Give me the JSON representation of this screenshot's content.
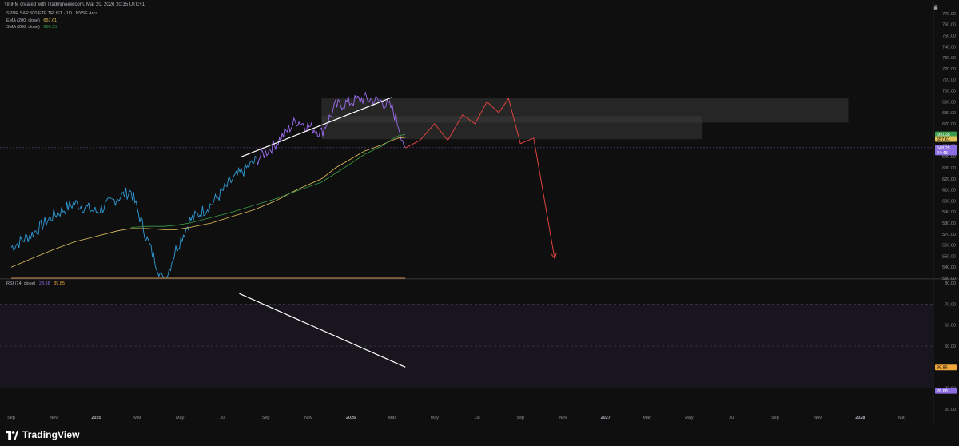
{
  "header": {
    "title": "YiniFM created with TradingView.com, Mar 20, 2026 20:35 UTC+1"
  },
  "legend": {
    "symbol": "SPDR S&P 500 ETF TRUST · 1D · NYSE Arca",
    "ema_label": "EMA (200, close)",
    "ema_value": "657.61",
    "sma_label": "SMA (200, close)",
    "sma_value": "660.35",
    "rsi_label": "RSI (14, close)",
    "rsi_value": "28.68",
    "rsi_ma_value": "39.85"
  },
  "footer": {
    "brand": "TradingView"
  },
  "colors": {
    "background": "#0f0f0f",
    "price_early": "#2f9bd6",
    "price_late": "#9b6cf0",
    "ema": "#e2c15a",
    "sma": "#3c9b4a",
    "forecast": "#e0443e",
    "rsi": "#8c6ee0",
    "rsi_ma": "#f0a83c",
    "zone": "#3a3a3a",
    "trendline": "#ffffff"
  },
  "chart_data": [
    {
      "type": "line",
      "title": "SPDR S&P 500 ETF TRUST · 1D · NYSE Arca",
      "x_tick_labels": [
        "Sep",
        "Nov",
        "2025",
        "Mar",
        "May",
        "Jul",
        "Sep",
        "Nov",
        "2026",
        "Mar",
        "May",
        "Jul",
        "Sep",
        "Nov",
        "2027",
        "Mar",
        "May",
        "Jul",
        "Sep",
        "Nov",
        "2028",
        "Mar"
      ],
      "y_tick_labels": [
        "770.00",
        "760.00",
        "750.00",
        "740.00",
        "730.00",
        "720.00",
        "710.00",
        "700.00",
        "690.00",
        "680.00",
        "670.00",
        "660.00",
        "650.00",
        "640.00",
        "630.00",
        "620.00",
        "610.00",
        "600.00",
        "590.00",
        "580.00",
        "570.00",
        "560.00",
        "550.00",
        "540.00",
        "530.00"
      ],
      "ylim": [
        530,
        775
      ],
      "x": [
        "2024-09-01",
        "2024-10-01",
        "2024-11-01",
        "2024-12-01",
        "2025-01-01",
        "2025-02-01",
        "2025-02-20",
        "2025-03-15",
        "2025-04-08",
        "2025-04-25",
        "2025-05-15",
        "2025-06-15",
        "2025-07-15",
        "2025-08-15",
        "2025-09-15",
        "2025-10-15",
        "2025-11-20",
        "2025-12-10",
        "2026-01-01",
        "2026-01-20",
        "2026-02-15",
        "2026-03-01",
        "2026-03-10",
        "2026-03-20"
      ],
      "series": [
        {
          "name": "SPDR S&P 500 ETF TRUST",
          "values": [
            558,
            570,
            587,
            598,
            590,
            603,
            609,
            565,
            525,
            556,
            582,
            597,
            619,
            635,
            652,
            673,
            662,
            686,
            690,
            693,
            690,
            684,
            669,
            648.25
          ]
        },
        {
          "name": "EMA (200, close)",
          "values": [
            540,
            548,
            556,
            563,
            568,
            573,
            575,
            575,
            574,
            574,
            576,
            580,
            586,
            592,
            600,
            610,
            620,
            630,
            638,
            645,
            651,
            655,
            657,
            657.61
          ]
        },
        {
          "name": "SMA (200, close)",
          "values": [
            null,
            null,
            null,
            null,
            null,
            null,
            576,
            577,
            577,
            578,
            580,
            585,
            590,
            596,
            602,
            609,
            617,
            625,
            634,
            642,
            650,
            656,
            659,
            660.35
          ]
        }
      ],
      "forecast_path": {
        "x": [
          "2026-03-20",
          "2026-04-10",
          "2026-05-01",
          "2026-05-20",
          "2026-06-10",
          "2026-06-28",
          "2026-07-15",
          "2026-08-01",
          "2026-08-15",
          "2026-09-01",
          "2026-09-20",
          "2026-10-20"
        ],
        "values": [
          648,
          655,
          670,
          655,
          678,
          670,
          690,
          680,
          693,
          652,
          657,
          548
        ]
      },
      "zones": [
        {
          "x": [
            "2025-11-20",
            "2027-12-15"
          ],
          "y": [
            671,
            693
          ]
        },
        {
          "x": [
            "2025-11-20",
            "2027-05-20"
          ],
          "y": [
            656,
            677
          ]
        }
      ],
      "trendline": {
        "x": [
          "2025-07-28",
          "2026-03-01"
        ],
        "values": [
          640,
          694
        ]
      },
      "last_price_labels": [
        "660.35",
        "657.61",
        "648.25",
        "24:48"
      ]
    },
    {
      "type": "line",
      "title": "RSI (14, close)",
      "y_tick_labels": [
        "80.00",
        "70.00",
        "60.00",
        "50.00",
        "40.00",
        "30.00",
        "20.00"
      ],
      "ylim": [
        20,
        80
      ],
      "x": [
        "2024-09-01",
        "2024-10-01",
        "2024-11-01",
        "2024-12-01",
        "2025-01-01",
        "2025-02-01",
        "2025-03-15",
        "2025-04-08",
        "2025-05-01",
        "2025-06-01",
        "2025-07-01",
        "2025-07-20",
        "2025-08-15",
        "2025-09-15",
        "2025-10-15",
        "2025-11-15",
        "2025-12-15",
        "2026-01-15",
        "2026-02-15",
        "2026-03-01",
        "2026-03-20"
      ],
      "series": [
        {
          "name": "RSI",
          "values": [
            48,
            62,
            70,
            44,
            58,
            62,
            35,
            25,
            52,
            60,
            68,
            72,
            58,
            66,
            60,
            50,
            57,
            53,
            50,
            45,
            28.68
          ]
        },
        {
          "name": "RSI MA",
          "values": [
            52,
            55,
            60,
            53,
            56,
            58,
            42,
            36,
            48,
            56,
            64,
            66,
            62,
            64,
            60,
            53,
            56,
            54,
            50,
            46,
            39.85
          ]
        }
      ],
      "bands": [
        30,
        70
      ],
      "trendline": {
        "x": [
          "2025-07-25",
          "2026-03-20"
        ],
        "values": [
          75,
          40
        ]
      },
      "last_value_labels": [
        "39.85",
        "28.68"
      ]
    }
  ]
}
